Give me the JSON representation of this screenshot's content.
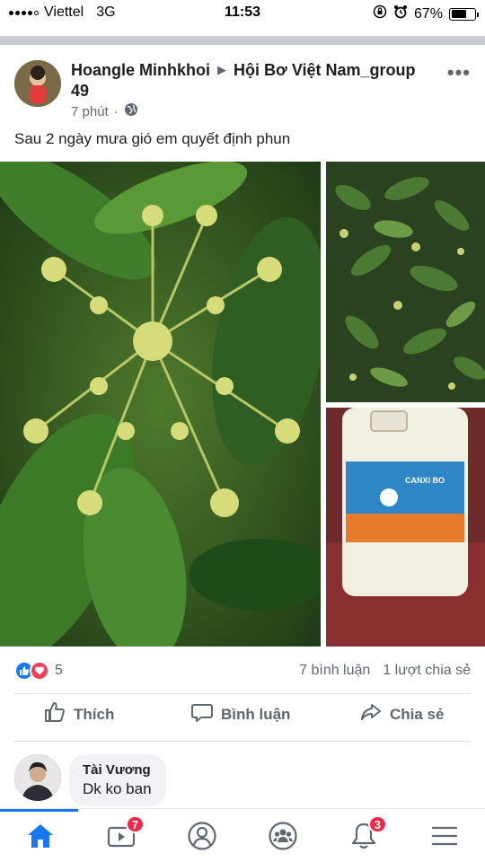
{
  "status_bar": {
    "carrier": "Viettel",
    "network": "3G",
    "time": "11:53",
    "battery": "67%",
    "battery_level": 0.67
  },
  "post": {
    "author": "Hoangle Minhkhoi",
    "group": "Hội Bơ Việt Nam_group 49",
    "time": "7 phút",
    "privacy_icon": "globe-icon",
    "text": "Sau 2 ngày mưa gió em quyết định phun",
    "photos": [
      {
        "subject": "avocado-flowers-closeup"
      },
      {
        "subject": "avocado-tree"
      },
      {
        "subject": "canxi-bo-fertilizer-jug",
        "label": "CANXI BO"
      }
    ]
  },
  "engagement": {
    "reaction_count": "5",
    "comments": "7 bình luận",
    "shares": "1 lượt chia sẻ"
  },
  "actions": {
    "like": "Thích",
    "comment": "Bình luận",
    "share": "Chia sẻ"
  },
  "comment": {
    "author": "Tài Vương",
    "text": "Dk ko ban"
  },
  "bottom_nav": {
    "video_badge": "7",
    "notifications_badge": "3"
  },
  "colors": {
    "accent": "#1877f2",
    "love": "#f33e58",
    "badge": "#f02849",
    "muted": "#606770"
  }
}
